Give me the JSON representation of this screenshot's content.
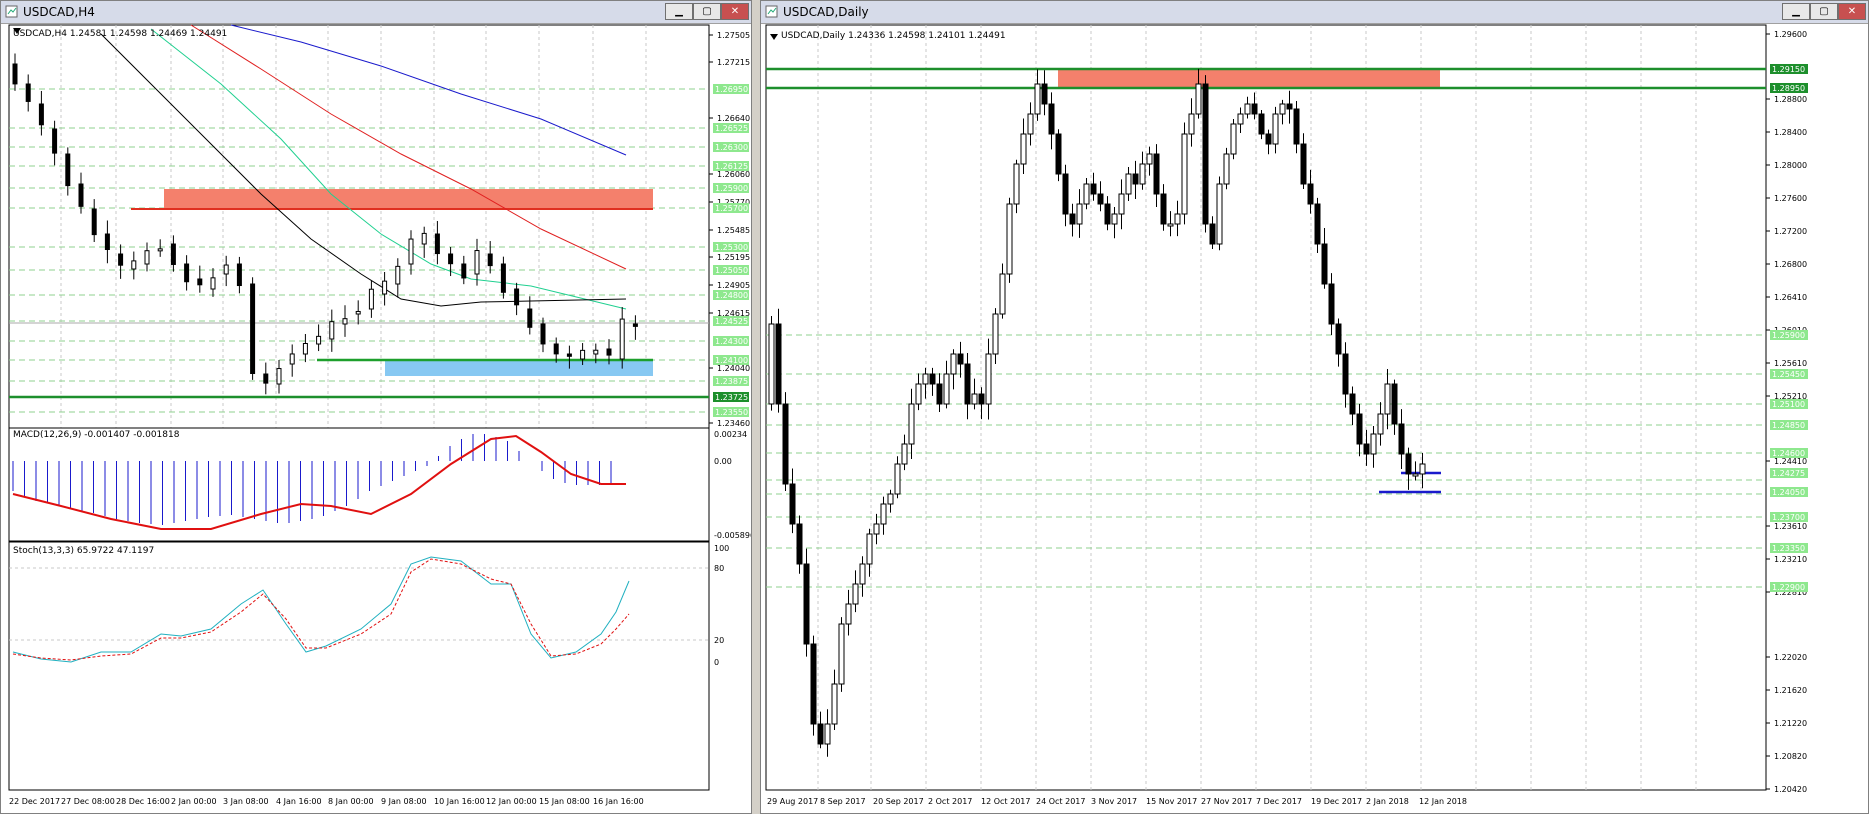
{
  "left_window": {
    "title": "USDCAD,H4",
    "header": "USDCAD,H4  1.24581 1.24598 1.24469 1.24491",
    "price_ticks": [
      "1.27505",
      "1.27215",
      "1.26640",
      "1.26060",
      "1.25770",
      "1.25485",
      "1.25195",
      "1.24905",
      "1.24615",
      "1.24040",
      "1.23460"
    ],
    "level_labels": [
      "1.26950",
      "1.26525",
      "1.26300",
      "1.26125",
      "1.25900",
      "1.25700",
      "1.25300",
      "1.25050",
      "1.24800",
      "1.24525",
      "1.24300",
      "1.24100",
      "1.23875",
      "1.23725",
      "1.23550"
    ],
    "time_labels": [
      "22 Dec 2017",
      "27 Dec 08:00",
      "28 Dec 16:00",
      "2 Jan 00:00",
      "3 Jan 08:00",
      "4 Jan 16:00",
      "8 Jan 00:00",
      "9 Jan 08:00",
      "10 Jan 16:00",
      "12 Jan 00:00",
      "15 Jan 08:00",
      "16 Jan 16:00"
    ],
    "macd": {
      "header": "MACD(12,26,9) -0.001407 -0.001818",
      "ticks": [
        "0.00234",
        "0.00",
        "-0.005896"
      ]
    },
    "stoch": {
      "header": "Stoch(13,3,3) 65.9722 47.1197",
      "ticks": [
        "100",
        "80",
        "20",
        "0"
      ]
    }
  },
  "right_window": {
    "title": "USDCAD,Daily",
    "header": "USDCAD,Daily  1.24336 1.24598 1.24101 1.24491",
    "price_ticks": [
      "1.29600",
      "1.28800",
      "1.28400",
      "1.28000",
      "1.27600",
      "1.27200",
      "1.26800",
      "1.26410",
      "1.26010",
      "1.25610",
      "1.25210",
      "1.24410",
      "1.23610",
      "1.23210",
      "1.22810",
      "1.22020",
      "1.21620",
      "1.21220",
      "1.20820",
      "1.20420"
    ],
    "level_labels": [
      "1.29150",
      "1.28950",
      "1.25900",
      "1.25450",
      "1.25100",
      "1.24850",
      "1.24600",
      "1.24275",
      "1.24050",
      "1.23700",
      "1.23350",
      "1.22900"
    ],
    "time_labels": [
      "29 Aug 2017",
      "8 Sep 2017",
      "20 Sep 2017",
      "2 Oct 2017",
      "12 Oct 2017",
      "24 Oct 2017",
      "3 Nov 2017",
      "15 Nov 2017",
      "27 Nov 2017",
      "7 Dec 2017",
      "19 Dec 2017",
      "2 Jan 2018",
      "12 Jan 2018"
    ]
  },
  "colors": {
    "level_label_bg": "#8ee88e",
    "resistance_zone": "#f4806c",
    "support_zone": "#87c8f2",
    "green_line": "#1d8f2c",
    "blue_line": "#1a1acc"
  }
}
